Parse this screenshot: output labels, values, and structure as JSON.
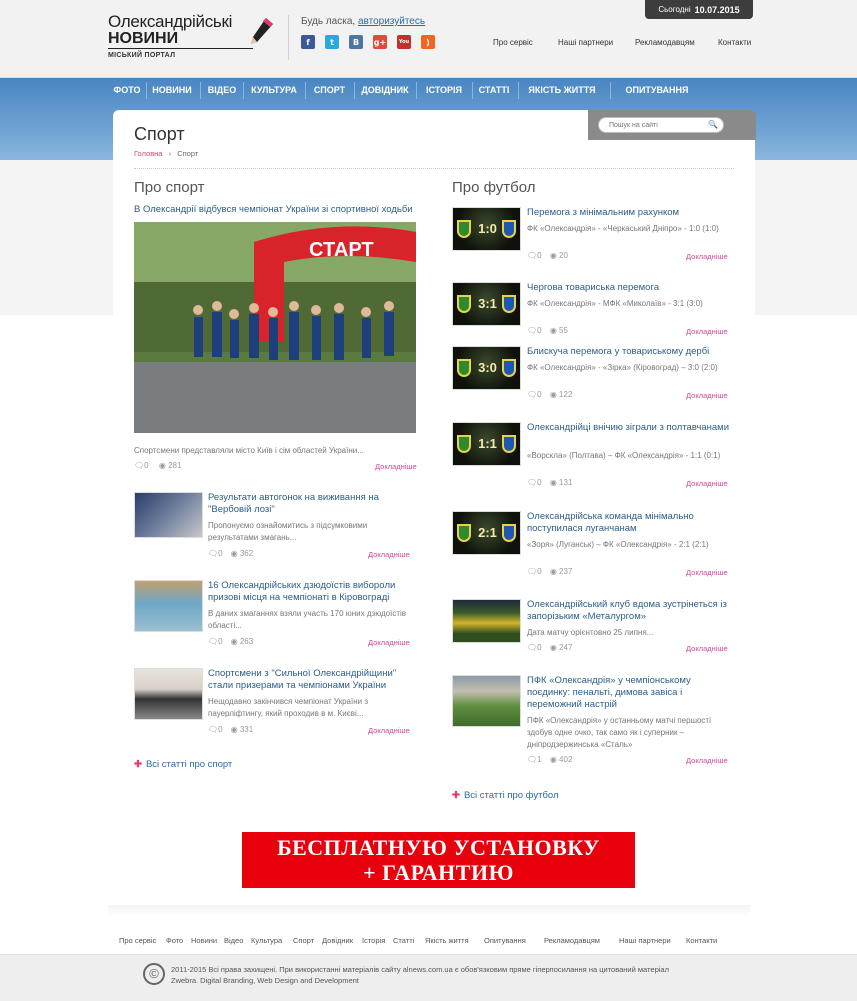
{
  "header": {
    "logo_line1": "Олександрійські",
    "logo_line2": "НОВИНИ",
    "logo_subtitle": "МІСЬКИЙ ПОРТАЛ",
    "login_prefix": "Будь ласка,",
    "login_link": "авторизуйтесь",
    "social": [
      {
        "name": "facebook-icon",
        "glyph": "f",
        "color": "#3b5998"
      },
      {
        "name": "twitter-icon",
        "glyph": "t",
        "color": "#2aa9e0"
      },
      {
        "name": "vk-icon",
        "glyph": "B",
        "color": "#4c75a3"
      },
      {
        "name": "google-plus-icon",
        "glyph": "g+",
        "color": "#dd4b39"
      },
      {
        "name": "youtube-icon",
        "glyph": "You",
        "color": "#c4302b"
      },
      {
        "name": "rss-icon",
        "glyph": ")",
        "color": "#f26522"
      }
    ],
    "top_links": [
      "Про сервіс",
      "Наші партнери",
      "Рекламодавцям",
      "Контакти"
    ],
    "date_label": "Сьогодні",
    "date_value": "10.07.2015"
  },
  "nav": [
    "ФОТО",
    "НОВИНИ",
    "ВІДЕО",
    "КУЛЬТУРА",
    "СПОРТ",
    "ДОВІДНИК",
    "ІСТОРІЯ",
    "СТАТТІ",
    "ЯКІСТЬ ЖИТТЯ",
    "ОПИТУВАННЯ"
  ],
  "search": {
    "placeholder": "Пошук на сайті"
  },
  "page": {
    "title": "Спорт",
    "breadcrumb_home": "Головна",
    "breadcrumb_sep": "›",
    "breadcrumb_current": "Спорт"
  },
  "left": {
    "title": "Про спорт",
    "featured": {
      "title": "В Олександрії відбувся чемпіонат України зі спортивної ходьби",
      "image_text": "СТАРТ",
      "excerpt": "Спортсмени представляли місто Київ і сім областей України...",
      "comments": "0",
      "views": "281",
      "more": "Докладніше"
    },
    "items": [
      {
        "title": "Результати автогонок на виживання на \"Вербовій лозі\"",
        "excerpt": "Пропонуємо ознайомитись з підсумковими результатами змагань...",
        "comments": "0",
        "views": "362",
        "more": "Докладніше"
      },
      {
        "title": "16 Олександрійських дзюдоїстів виборoли призові місця на чемпіонаті в Кіровограді",
        "excerpt": "В даних змаганнях взяли участь 170 юних дзюдоїстів області...",
        "comments": "0",
        "views": "263",
        "more": "Докладніше"
      },
      {
        "title": "Спортсмени з \"Сильної Олександрійщини\" стали призерами та чемпіонами України",
        "excerpt": "Нещодавно закінчився чемпіонат України з пауерліфтингу, який проходив в м. Києві...",
        "comments": "0",
        "views": "331",
        "more": "Докладніше"
      }
    ],
    "all_link": "Всі статті про спорт"
  },
  "right": {
    "title": "Про футбол",
    "items": [
      {
        "title": "Перемога з мінімальним рахунком",
        "excerpt": "ФК «Олександрія» - «Черкаський Дніпро» - 1:0 (1:0)",
        "score": "1:0",
        "comments": "0",
        "views": "20",
        "more": "Докладніше"
      },
      {
        "title": "Чергова товариська перемога",
        "excerpt": "ФК «Олександрія» - МФК «Миколаїв» - 3:1 (3:0)",
        "score": "3:1",
        "comments": "0",
        "views": "55",
        "more": "Докладніше"
      },
      {
        "title": "Блискуча перемога у товариському дербі",
        "excerpt": "ФК «Олександрія» - «Зірка» (Кіровоград) – 3:0 (2:0)",
        "score": "3:0",
        "comments": "0",
        "views": "122",
        "more": "Докладніше"
      },
      {
        "title": "Олександрійці внічию зіграли з полтавчанами",
        "excerpt": "«Ворскла» (Полтава) – ФК «Олександрія» - 1:1 (0:1)",
        "score": "1:1",
        "comments": "0",
        "views": "131",
        "more": "Докладніше"
      },
      {
        "title": "Олександрійська команда мінімально поступилася луганчанам",
        "excerpt": "«Зоря» (Луганськ) – ФК «Олександрія» - 2:1 (2:1)",
        "score": "2:1",
        "comments": "0",
        "views": "237",
        "more": "Докладніше"
      },
      {
        "title": "Олександрійський клуб вдома зустрінеться із запорізьким «Металургом»",
        "excerpt": "Дата матчу орієнтовно 25 липня...",
        "score": "",
        "comments": "0",
        "views": "247",
        "more": "Докладніше"
      },
      {
        "title": "ПФК «Олександрія» у чемпіонському поєдинку: пенальті, димова завіса і переможний настрій",
        "excerpt": "ПФК «Олександрія» у останньому матчі першості здобув одне очко, так само як і суперник – дніпродзержинська «Сталь»",
        "score": "",
        "comments": "1",
        "views": "402",
        "more": "Докладніше"
      }
    ],
    "all_link": "Всі статті про футбол"
  },
  "ad": {
    "line1": "БЕСПЛАТНУЮ УСТАНОВКУ",
    "line2": "+ ГАРАНТИЮ"
  },
  "footer": {
    "links": [
      "Про сервіс",
      "Фото",
      "Новини",
      "Відео",
      "Культура",
      "Спорт",
      "Довідник",
      "Історія",
      "Статті",
      "Якість життя",
      "Опитування",
      "Рекламодавцям",
      "Наші партнери",
      "Контакти"
    ],
    "copyright_line1": "2011-2015 Всі права захищені. При використанні матеріалів сайту alnews.com.ua є обов'язковим пряме гіперпосилання на цитований матеріал",
    "copyright_line2": "Zwebra. Digital Branding, Web Design and Development"
  }
}
